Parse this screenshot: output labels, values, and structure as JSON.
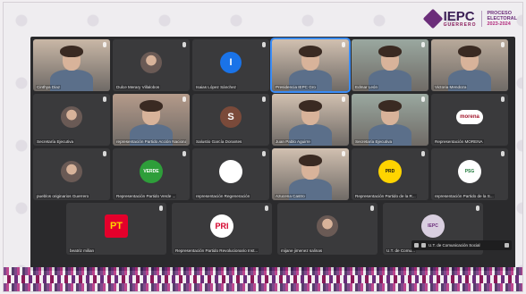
{
  "header": {
    "logo_text": "IEPC",
    "logo_sub": "GUERRERO",
    "proceso_lines": [
      "PROCESO",
      "ELECTORAL",
      "2023-2024"
    ]
  },
  "participants": [
    {
      "name": "Cinthya Diaz",
      "type": "video"
    },
    {
      "name": "Dulce Merary Villalobos",
      "type": "photo"
    },
    {
      "name": "Isaias López Sánchez",
      "type": "initial",
      "initial": "I",
      "color": "#1a73e8"
    },
    {
      "name": "Presidencia IEPC Gro",
      "type": "video",
      "speaking": true
    },
    {
      "name": "Edmar León",
      "type": "video"
    },
    {
      "name": "Victoria Mendoza",
      "type": "video"
    },
    {
      "name": "Secretaría Ejecutiva",
      "type": "photo"
    },
    {
      "name": "representación Partido Acción Nacional",
      "type": "video"
    },
    {
      "name": "Salustio García Dorantes",
      "type": "initial",
      "initial": "S",
      "color": "#7a4a3a"
    },
    {
      "name": "Juan Pablo Aguirre",
      "type": "video"
    },
    {
      "name": "Secretaría Ejecutiva",
      "type": "video"
    },
    {
      "name": "Representación MORENA",
      "type": "logo",
      "logo": "morena"
    },
    {
      "name": "pueblos originarios Guerrero",
      "type": "photo"
    },
    {
      "name": "Representación Partido Verde ...",
      "type": "logo",
      "logo": "verde"
    },
    {
      "name": "representación Regeneración",
      "type": "logo",
      "logo": "regeneracion"
    },
    {
      "name": "Azucena Castro",
      "type": "video"
    },
    {
      "name": "Representación Partido de la R...",
      "type": "logo",
      "logo": "prd"
    },
    {
      "name": "representación Partido de la S...",
      "type": "logo",
      "logo": "psg"
    },
    {
      "name": "beatriz milian",
      "type": "logo",
      "logo": "pt"
    },
    {
      "name": "Representación Partido Revolucionario Inst...",
      "type": "logo",
      "logo": "pri"
    },
    {
      "name": "mijane jimenez salinas",
      "type": "photo"
    },
    {
      "name": "U.T. de Comu...",
      "type": "logo",
      "logo": "iepc"
    }
  ],
  "bottombar": {
    "label": "U.T. de Comunicación Social"
  },
  "logos": {
    "morena": "morena",
    "verde": "VERDE",
    "pt": "PT",
    "pri": "PRI",
    "prd": "PRD",
    "psg": "PSG",
    "iepc": "IEPC"
  }
}
